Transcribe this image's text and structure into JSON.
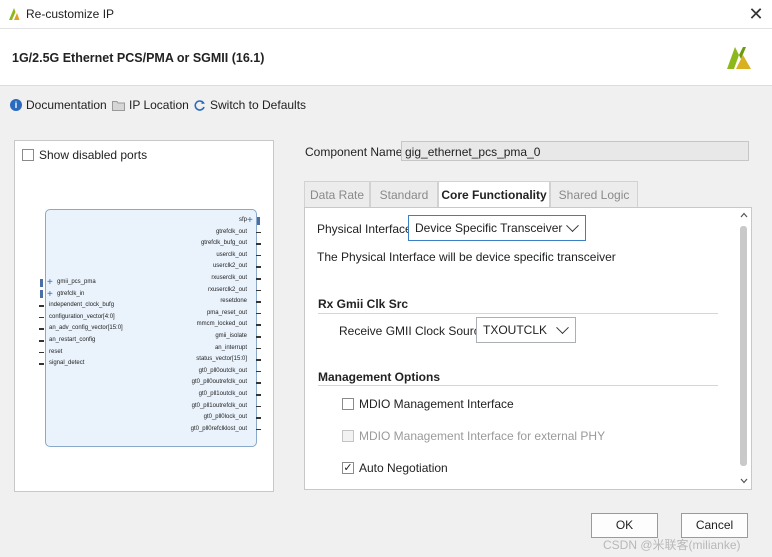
{
  "window": {
    "title": "Re-customize IP",
    "close_icon": "close-icon"
  },
  "header": {
    "title": "1G/2.5G Ethernet PCS/PMA or SGMII (16.1)",
    "logo": "xilinx-logo-icon",
    "logo_color": "#8cb81c"
  },
  "toolbar": {
    "documentation": "Documentation",
    "ip_location": "IP Location",
    "switch_defaults": "Switch to Defaults"
  },
  "left_panel": {
    "show_disabled_ports": "Show disabled ports",
    "block": {
      "left_ports": [
        "gmii_pcs_pma",
        "gtrefclk_in",
        "independent_clock_bufg",
        "configuration_vector[4:0]",
        "an_adv_config_vector[15:0]",
        "an_restart_config",
        "reset",
        "signal_detect"
      ],
      "right_ports": [
        "sfp",
        "gtrefclk_out",
        "gtrefclk_bufg_out",
        "userclk_out",
        "userclk2_out",
        "rxuserclk_out",
        "rxuserclk2_out",
        "resetdone",
        "pma_reset_out",
        "mmcm_locked_out",
        "gmii_isolate",
        "an_interrupt",
        "status_vector[15:0]",
        "gt0_pll0outclk_out",
        "gt0_pll0outrefclk_out",
        "gt0_pll1outclk_out",
        "gt0_pll1outrefclk_out",
        "gt0_pll0lock_out",
        "gt0_pll0refclklost_out"
      ]
    }
  },
  "component": {
    "label": "Component Name",
    "value": "gig_ethernet_pcs_pma_0"
  },
  "tabs": [
    "Data Rate",
    "Standard",
    "Core Functionality",
    "Shared Logic"
  ],
  "core_functionality": {
    "physical_interface_label": "Physical Interface",
    "physical_interface_value": "Device Specific Transceiver",
    "physical_interface_note": "The Physical Interface will be device specific transceiver",
    "rx_section": "Rx Gmii Clk Src",
    "receive_clock_label": "Receive GMII Clock Source",
    "receive_clock_value": "TXOUTCLK",
    "mgmt_section": "Management Options",
    "mdio_label": "MDIO Management Interface",
    "mdio_checked": false,
    "mdio_ext_label": "MDIO Management Interface for external PHY",
    "mdio_ext_enabled": false,
    "autoneg_label": "Auto Negotiation",
    "autoneg_checked": true
  },
  "buttons": {
    "ok": "OK",
    "cancel": "Cancel"
  },
  "watermark": "CSDN @米联客(milianke)",
  "colors": {
    "accent": "#2a6bbf",
    "tab_active_bg": "#ffffff",
    "block_fill": "#eaf3fc"
  }
}
